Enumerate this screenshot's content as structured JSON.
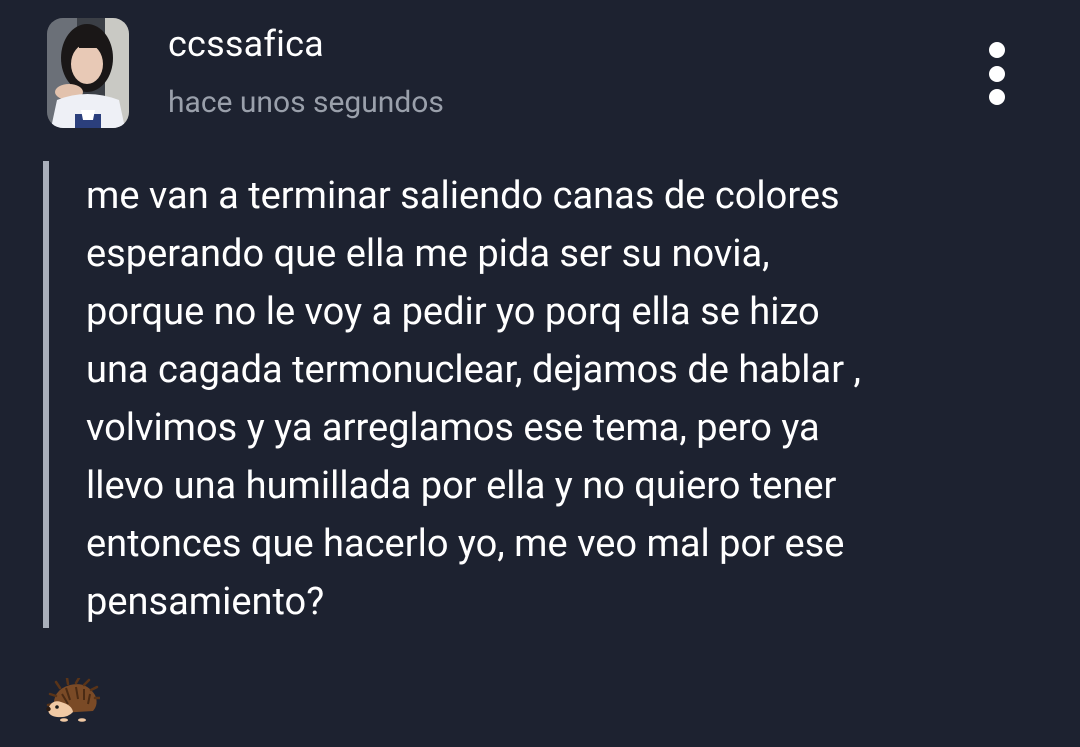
{
  "post": {
    "author": "ccssafica",
    "timestamp": "hace unos segundos",
    "body": "me van a terminar saliendo canas de colores\nesperando que ella me pida ser su novia,\nporque no le voy a pedir yo porq ella se hizo\nuna cagada termonuclear, dejamos de hablar ,\nvolvimos y ya arreglamos ese tema, pero ya\nllevo una humillada por ella y no quiero tener\nentonces que hacerlo yo, me veo mal por ese\npensamiento?"
  },
  "icons": {
    "avatar": "profile-photo",
    "more_options": "more-vertical-icon",
    "reaction": "hedgehog-icon"
  },
  "colors": {
    "background": "#1d2230",
    "text": "#ffffff",
    "muted_text": "#9aa0ab",
    "quote_bar": "#a9afbb"
  }
}
